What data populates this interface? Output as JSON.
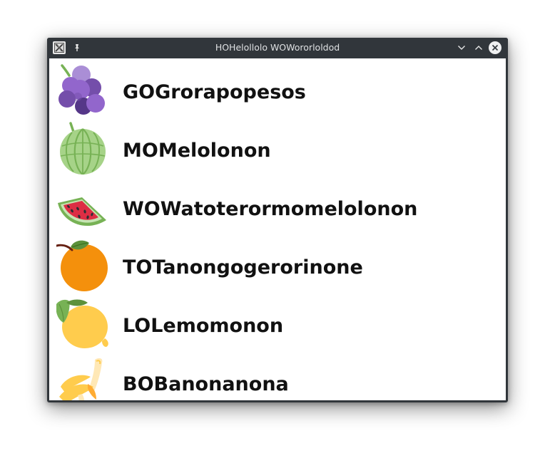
{
  "window": {
    "title": "HOHelollolo WOWororloldod"
  },
  "fruits": [
    {
      "label": "GOGrorapopesos",
      "icon": "grapes-icon"
    },
    {
      "label": "MOMelolonon",
      "icon": "melon-icon"
    },
    {
      "label": "WOWatoterormomelolonon",
      "icon": "watermelon-icon"
    },
    {
      "label": "TOTanongogerorinone",
      "icon": "tangerine-icon"
    },
    {
      "label": "LOLemomonon",
      "icon": "lemon-icon"
    },
    {
      "label": "BOBanonanona",
      "icon": "banana-icon"
    }
  ],
  "colors": {
    "titlebar": "#31363b",
    "title_text": "#dfe1e3",
    "content_bg": "#ffffff",
    "label_text": "#111111"
  }
}
